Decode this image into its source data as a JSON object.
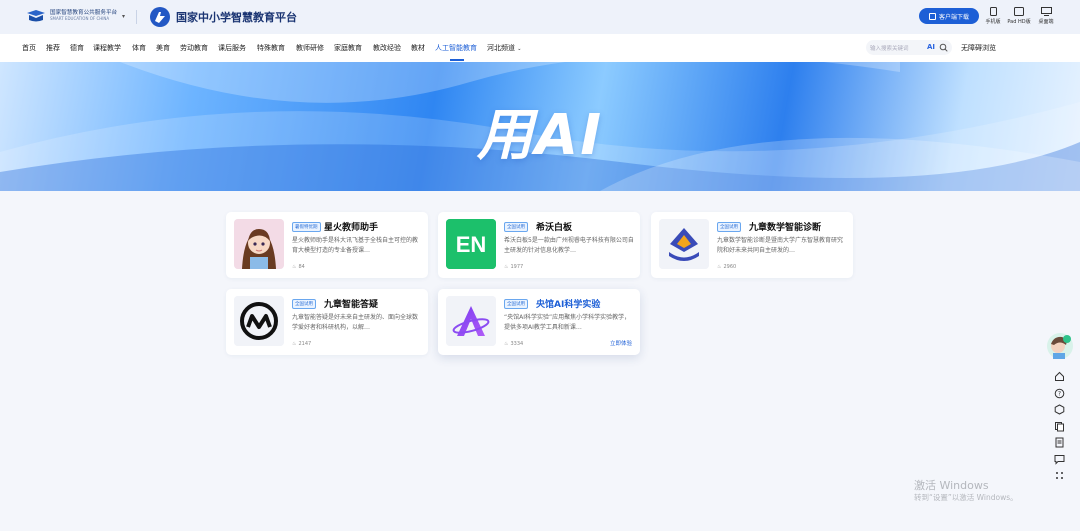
{
  "header": {
    "platform_cn": "国家智慧教育公共服务平台",
    "platform_en": "SMART EDUCATION OF CHINA",
    "site_name": "国家中小学智慧教育平台",
    "download_label": "客户端下载",
    "devices": [
      {
        "label": "手机版",
        "icon": "phone-icon"
      },
      {
        "label": "Pad HD版",
        "icon": "tablet-icon"
      },
      {
        "label": "桌面端",
        "icon": "desktop-icon"
      }
    ]
  },
  "nav": {
    "items": [
      "首页",
      "推荐",
      "德育",
      "课程教学",
      "体育",
      "美育",
      "劳动教育",
      "课后服务",
      "特殊教育",
      "教师研修",
      "家庭教育",
      "教改经验",
      "教材",
      "人工智能教育",
      "河北频道"
    ],
    "active": "人工智能教育",
    "search_placeholder": "输入搜索关键词",
    "ai_label": "AI",
    "barrier_label": "无障碍浏览"
  },
  "banner": {
    "title": "用AI"
  },
  "cards": [
    {
      "badge": "暑假特优期",
      "title": "星火教师助手",
      "desc": "星火教师助手是科大讯飞基于全栈自主可控的教育大模型打造的专业备授课…",
      "views": "84",
      "icon": "teacher-avatar-icon"
    },
    {
      "badge": "全国试用",
      "title": "希沃白板",
      "desc": "希沃白板5是一款由广州视睿电子科技有限公司自主研发的针对信息化教学…",
      "views": "1977",
      "icon": "en-logo-icon"
    },
    {
      "badge": "全国试用",
      "title": "九章数学智能诊断",
      "desc": "九章数学智能诊断是暨南大学广东智慧教育研究院和好未来共同自主研发的…",
      "views": "2960",
      "icon": "jiuzhang-diagnosis-icon"
    },
    {
      "badge": "全国试用",
      "title": "九章智能答疑",
      "desc": "九章智能答疑是好未来自主研发的、面向全球数学爱好者和科研机构，以解…",
      "views": "2147",
      "icon": "jiuzhang-answer-icon"
    },
    {
      "badge": "全国试用",
      "title": "央馆AI科学实验",
      "desc": "“央馆AI科学实验”应用聚焦小学科学实验教学，提供多项AI教学工具和新课…",
      "views": "3334",
      "icon": "science-a-icon",
      "link": "立即体验"
    }
  ],
  "side_tools": [
    "home-icon",
    "help-icon",
    "box-icon",
    "copy-icon",
    "document-icon",
    "message-icon",
    "grid-icon"
  ],
  "watermark": {
    "line1": "激活 Windows",
    "line2": "转到“设置”以激活 Windows。"
  },
  "colors": {
    "accent": "#1d5fd6",
    "page_bg": "#f4f6fb"
  }
}
